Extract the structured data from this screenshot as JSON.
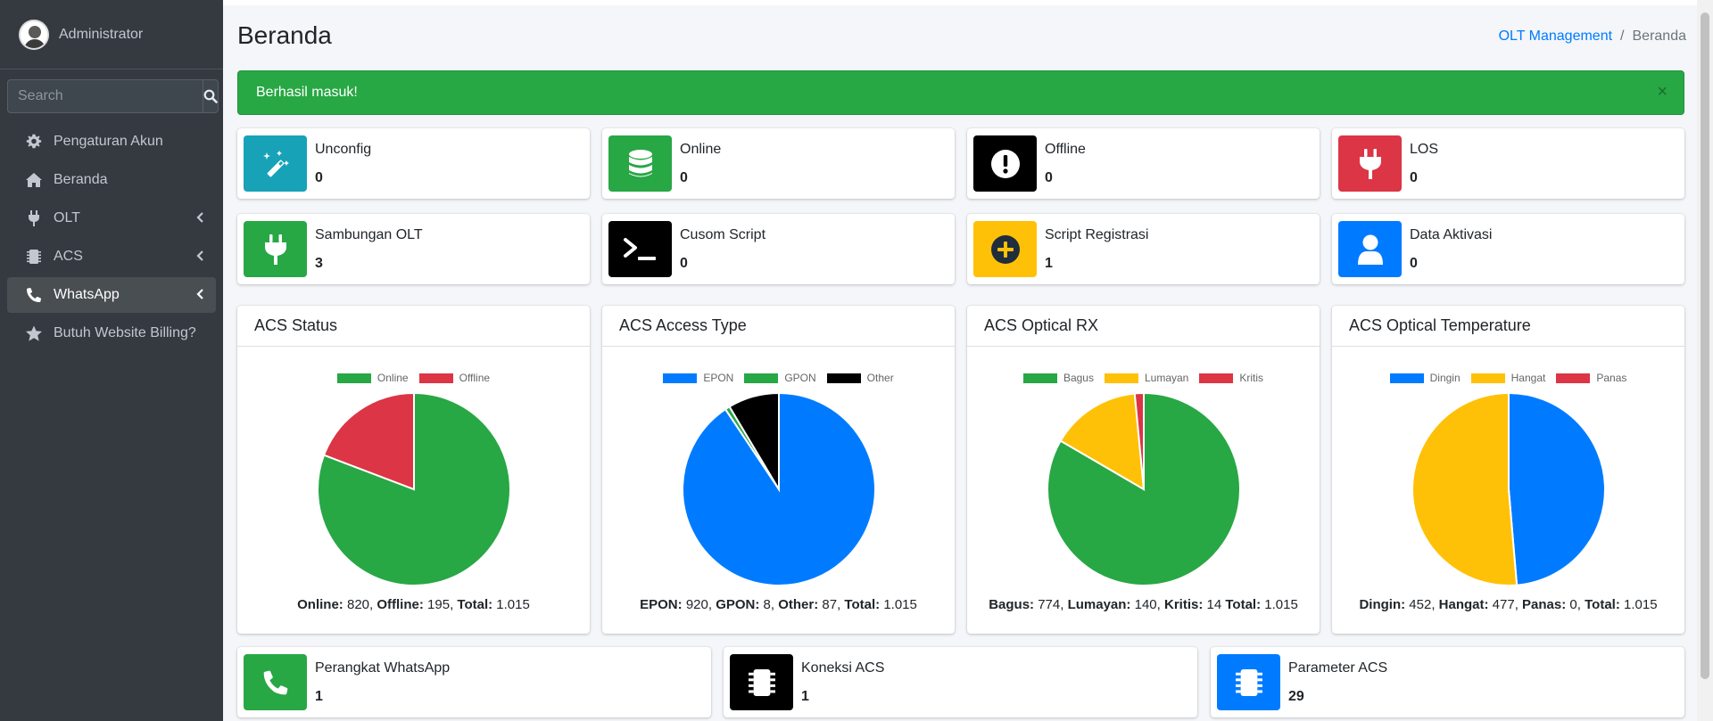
{
  "user": {
    "name": "Administrator"
  },
  "search": {
    "placeholder": "Search"
  },
  "sidebar": {
    "items": [
      {
        "label": "Pengaturan Akun",
        "icon": "gear-icon"
      },
      {
        "label": "Beranda",
        "icon": "home-icon"
      },
      {
        "label": "OLT",
        "icon": "plug-icon"
      },
      {
        "label": "ACS",
        "icon": "microchip-icon"
      },
      {
        "label": "WhatsApp",
        "icon": "phone-icon"
      },
      {
        "label": "Butuh Website Billing?",
        "icon": "star-icon"
      }
    ]
  },
  "header": {
    "title": "Beranda"
  },
  "breadcrumb": {
    "link": "OLT Management",
    "current": "Beranda"
  },
  "alert": {
    "message": "Berhasil masuk!",
    "close": "×"
  },
  "boxes_row1": [
    {
      "label": "Unconfig",
      "value": "0",
      "color": "#17a2b8",
      "icon": "magic-wand-icon"
    },
    {
      "label": "Online",
      "value": "0",
      "color": "#28a745",
      "icon": "database-icon"
    },
    {
      "label": "Offline",
      "value": "0",
      "color": "#000000",
      "icon": "exclamation-icon"
    },
    {
      "label": "LOS",
      "value": "0",
      "color": "#dc3545",
      "icon": "plug-icon"
    }
  ],
  "boxes_row2": [
    {
      "label": "Sambungan OLT",
      "value": "3",
      "color": "#28a745",
      "icon": "plug-icon"
    },
    {
      "label": "Cusom Script",
      "value": "0",
      "color": "#000000",
      "icon": "terminal-icon"
    },
    {
      "label": "Script Registrasi",
      "value": "1",
      "color": "#ffc107",
      "icon": "plus-circle-icon"
    },
    {
      "label": "Data Aktivasi",
      "value": "0",
      "color": "#007bff",
      "icon": "user-icon"
    }
  ],
  "boxes_row3": [
    {
      "label": "Perangkat WhatsApp",
      "value": "1",
      "color": "#28a745",
      "icon": "phone-icon"
    },
    {
      "label": "Koneksi ACS",
      "value": "1",
      "color": "#000000",
      "icon": "microchip-icon"
    },
    {
      "label": "Parameter ACS",
      "value": "29",
      "color": "#007bff",
      "icon": "microchip-icon"
    }
  ],
  "chart_data": [
    {
      "type": "pie",
      "title": "ACS Status",
      "categories": [
        "Online",
        "Offline"
      ],
      "values": [
        820,
        195
      ],
      "colors": [
        "#28a745",
        "#dc3545"
      ],
      "legend": "top",
      "summary": [
        {
          "label": "Online:",
          "value": "820"
        },
        {
          "label": "Offline:",
          "value": "195"
        },
        {
          "label": "Total:",
          "value": "1.015"
        }
      ]
    },
    {
      "type": "pie",
      "title": "ACS Access Type",
      "categories": [
        "EPON",
        "GPON",
        "Other"
      ],
      "values": [
        920,
        8,
        87
      ],
      "colors": [
        "#007bff",
        "#28a745",
        "#000000"
      ],
      "legend": "top",
      "summary": [
        {
          "label": "EPON:",
          "value": "920"
        },
        {
          "label": "GPON:",
          "value": "8"
        },
        {
          "label": "Other:",
          "value": "87"
        },
        {
          "label": "Total:",
          "value": "1.015"
        }
      ]
    },
    {
      "type": "pie",
      "title": "ACS Optical RX",
      "categories": [
        "Bagus",
        "Lumayan",
        "Kritis"
      ],
      "values": [
        774,
        140,
        14
      ],
      "colors": [
        "#28a745",
        "#ffc107",
        "#dc3545"
      ],
      "legend": "top",
      "summary": [
        {
          "label": "Bagus:",
          "value": "774"
        },
        {
          "label": "Lumayan:",
          "value": "140"
        },
        {
          "label": "Kritis:",
          "value": "14"
        },
        {
          "label": "Total:",
          "value": "1.015"
        }
      ]
    },
    {
      "type": "pie",
      "title": "ACS Optical Temperature",
      "categories": [
        "Dingin",
        "Hangat",
        "Panas"
      ],
      "values": [
        452,
        477,
        0
      ],
      "colors": [
        "#007bff",
        "#ffc107",
        "#dc3545"
      ],
      "legend": "top",
      "summary": [
        {
          "label": "Dingin:",
          "value": "452"
        },
        {
          "label": "Hangat:",
          "value": "477"
        },
        {
          "label": "Panas:",
          "value": "0"
        },
        {
          "label": "Total:",
          "value": "1.015"
        }
      ]
    }
  ]
}
